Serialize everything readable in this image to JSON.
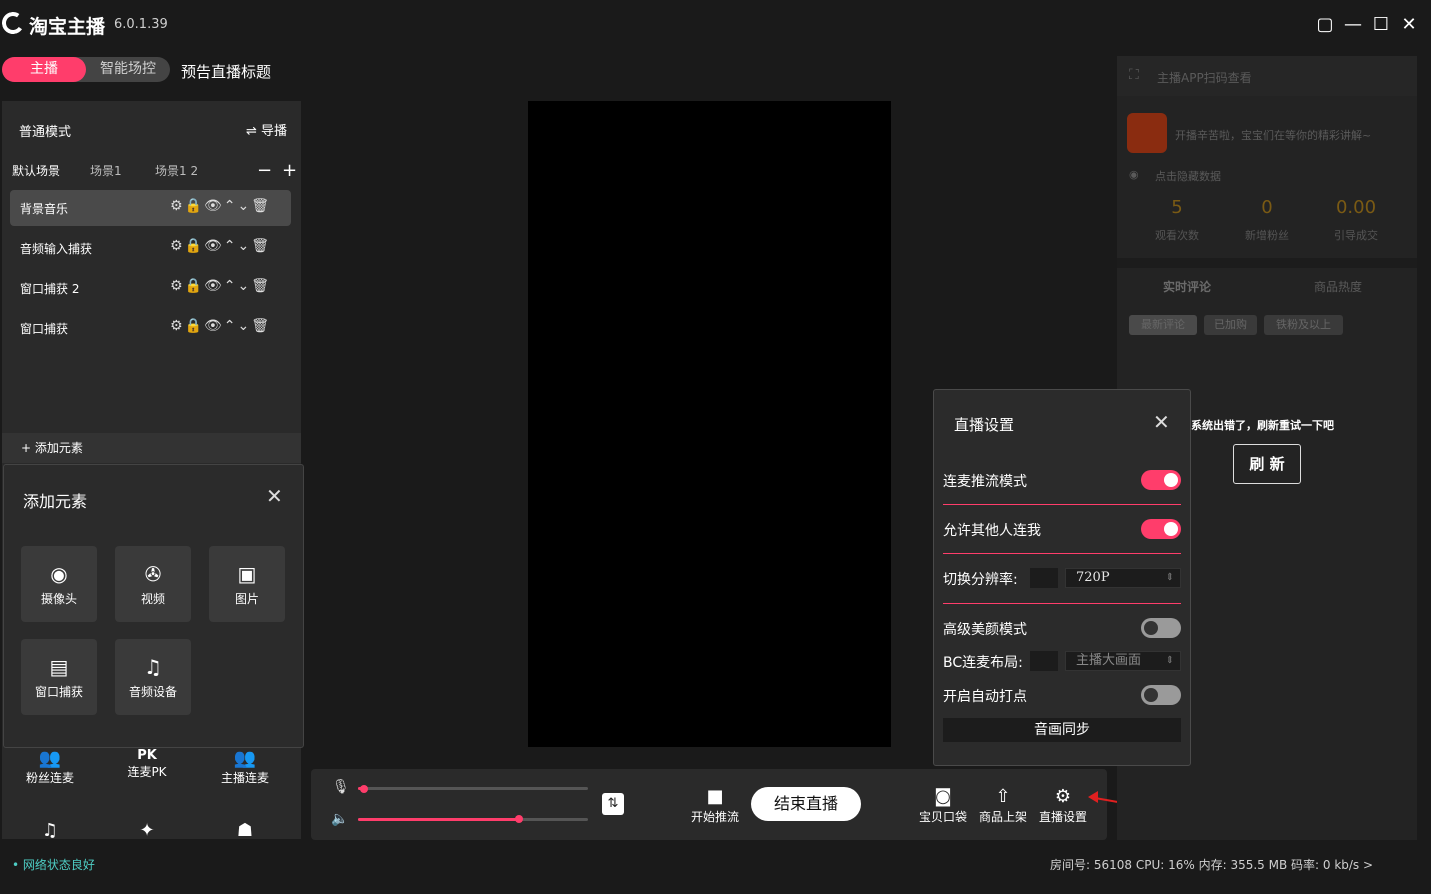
{
  "app": {
    "name": "淘宝主播",
    "version": "6.0.1.39"
  },
  "window_controls": {
    "pin": "▢",
    "minimize": "—",
    "maximize": "☐",
    "close": "✕"
  },
  "mode_tabs": {
    "host": "主播",
    "smart": "智能场控",
    "preview_title": "预告直播标题"
  },
  "left_panel": {
    "mode": "普通模式",
    "guide": "⇌ 导播",
    "scenes": [
      "默认场景",
      "场景1",
      "场景1 2"
    ],
    "scene_minus": "−",
    "scene_plus": "+",
    "layers": [
      "背景音乐",
      "音频输入捕获",
      "窗口捕获 2",
      "窗口捕获"
    ],
    "layer_icons": "⚙🔒👁⌃⌄🗑",
    "add_element": "+ 添加元素"
  },
  "add_element_popup": {
    "title": "添加元素",
    "close": "✕",
    "tiles": [
      {
        "icon": "webcam-icon",
        "glyph": "◉",
        "label": "摄像头"
      },
      {
        "icon": "film-reel-icon",
        "glyph": "✇",
        "label": "视频"
      },
      {
        "icon": "image-icon",
        "glyph": "▣",
        "label": "图片"
      },
      {
        "icon": "window-icon",
        "glyph": "▤",
        "label": "窗口捕获"
      },
      {
        "icon": "music-note-icon",
        "glyph": "♫",
        "label": "音频设备"
      }
    ]
  },
  "lower_actions": [
    {
      "icon": "fans-link-icon",
      "glyph": "👥",
      "label": "粉丝连麦"
    },
    {
      "icon": "pk-icon",
      "glyph": "PK",
      "label": "连麦PK"
    },
    {
      "icon": "host-link-icon",
      "glyph": "👥",
      "label": "主播连麦"
    },
    {
      "icon": "music-icon",
      "glyph": "♫",
      "label": ""
    },
    {
      "icon": "effects-icon",
      "glyph": "✦",
      "label": ""
    },
    {
      "icon": "robot-icon",
      "glyph": "☗",
      "label": ""
    }
  ],
  "control_bar": {
    "mic_level": 0.01,
    "volume_level": 0.7,
    "start_push": "开始推流",
    "end_live": "结束直播",
    "bag": "宝贝口袋",
    "upload": "商品上架",
    "settings": "直播设置"
  },
  "right_panel": {
    "scan_title": "主播APP扫码查看",
    "welcome": "开播辛苦啦，宝宝们在等你的精彩讲解~",
    "hide_data": "点击隐藏数据",
    "stats": [
      {
        "value": "5",
        "label": "观看次数"
      },
      {
        "value": "0",
        "label": "新增粉丝"
      },
      {
        "value": "0.00",
        "label": "引导成交"
      }
    ],
    "tabs": [
      "实时评论",
      "商品热度"
    ],
    "filters": [
      "最新评论",
      "已加购",
      "铁粉及以上"
    ],
    "error": "系统出错了，刷新重试一下吧",
    "refresh": "刷 新"
  },
  "live_settings": {
    "title": "直播设置",
    "close": "✕",
    "link_push_mode": {
      "label": "连麦推流模式",
      "on": true
    },
    "allow_link": {
      "label": "允许其他人连我",
      "on": true
    },
    "resolution": {
      "label": "切换分辨率:",
      "value": "720P"
    },
    "beauty": {
      "label": "高级美颜模式",
      "on": false
    },
    "bc_layout": {
      "label": "BC连麦布局:",
      "value": "主播大画面"
    },
    "auto_mark": {
      "label": "开启自动打点",
      "on": false
    },
    "av_sync": "音画同步"
  },
  "status": {
    "network": "• 网络状态良好",
    "info": "房间号: 56108   CPU: 16%   内存: 355.5 MB   码率: 0 kb/s    >"
  },
  "colors": {
    "accent": "#ff3d6b",
    "bg": "#1a1a1a",
    "panel": "#2a2a2a"
  }
}
